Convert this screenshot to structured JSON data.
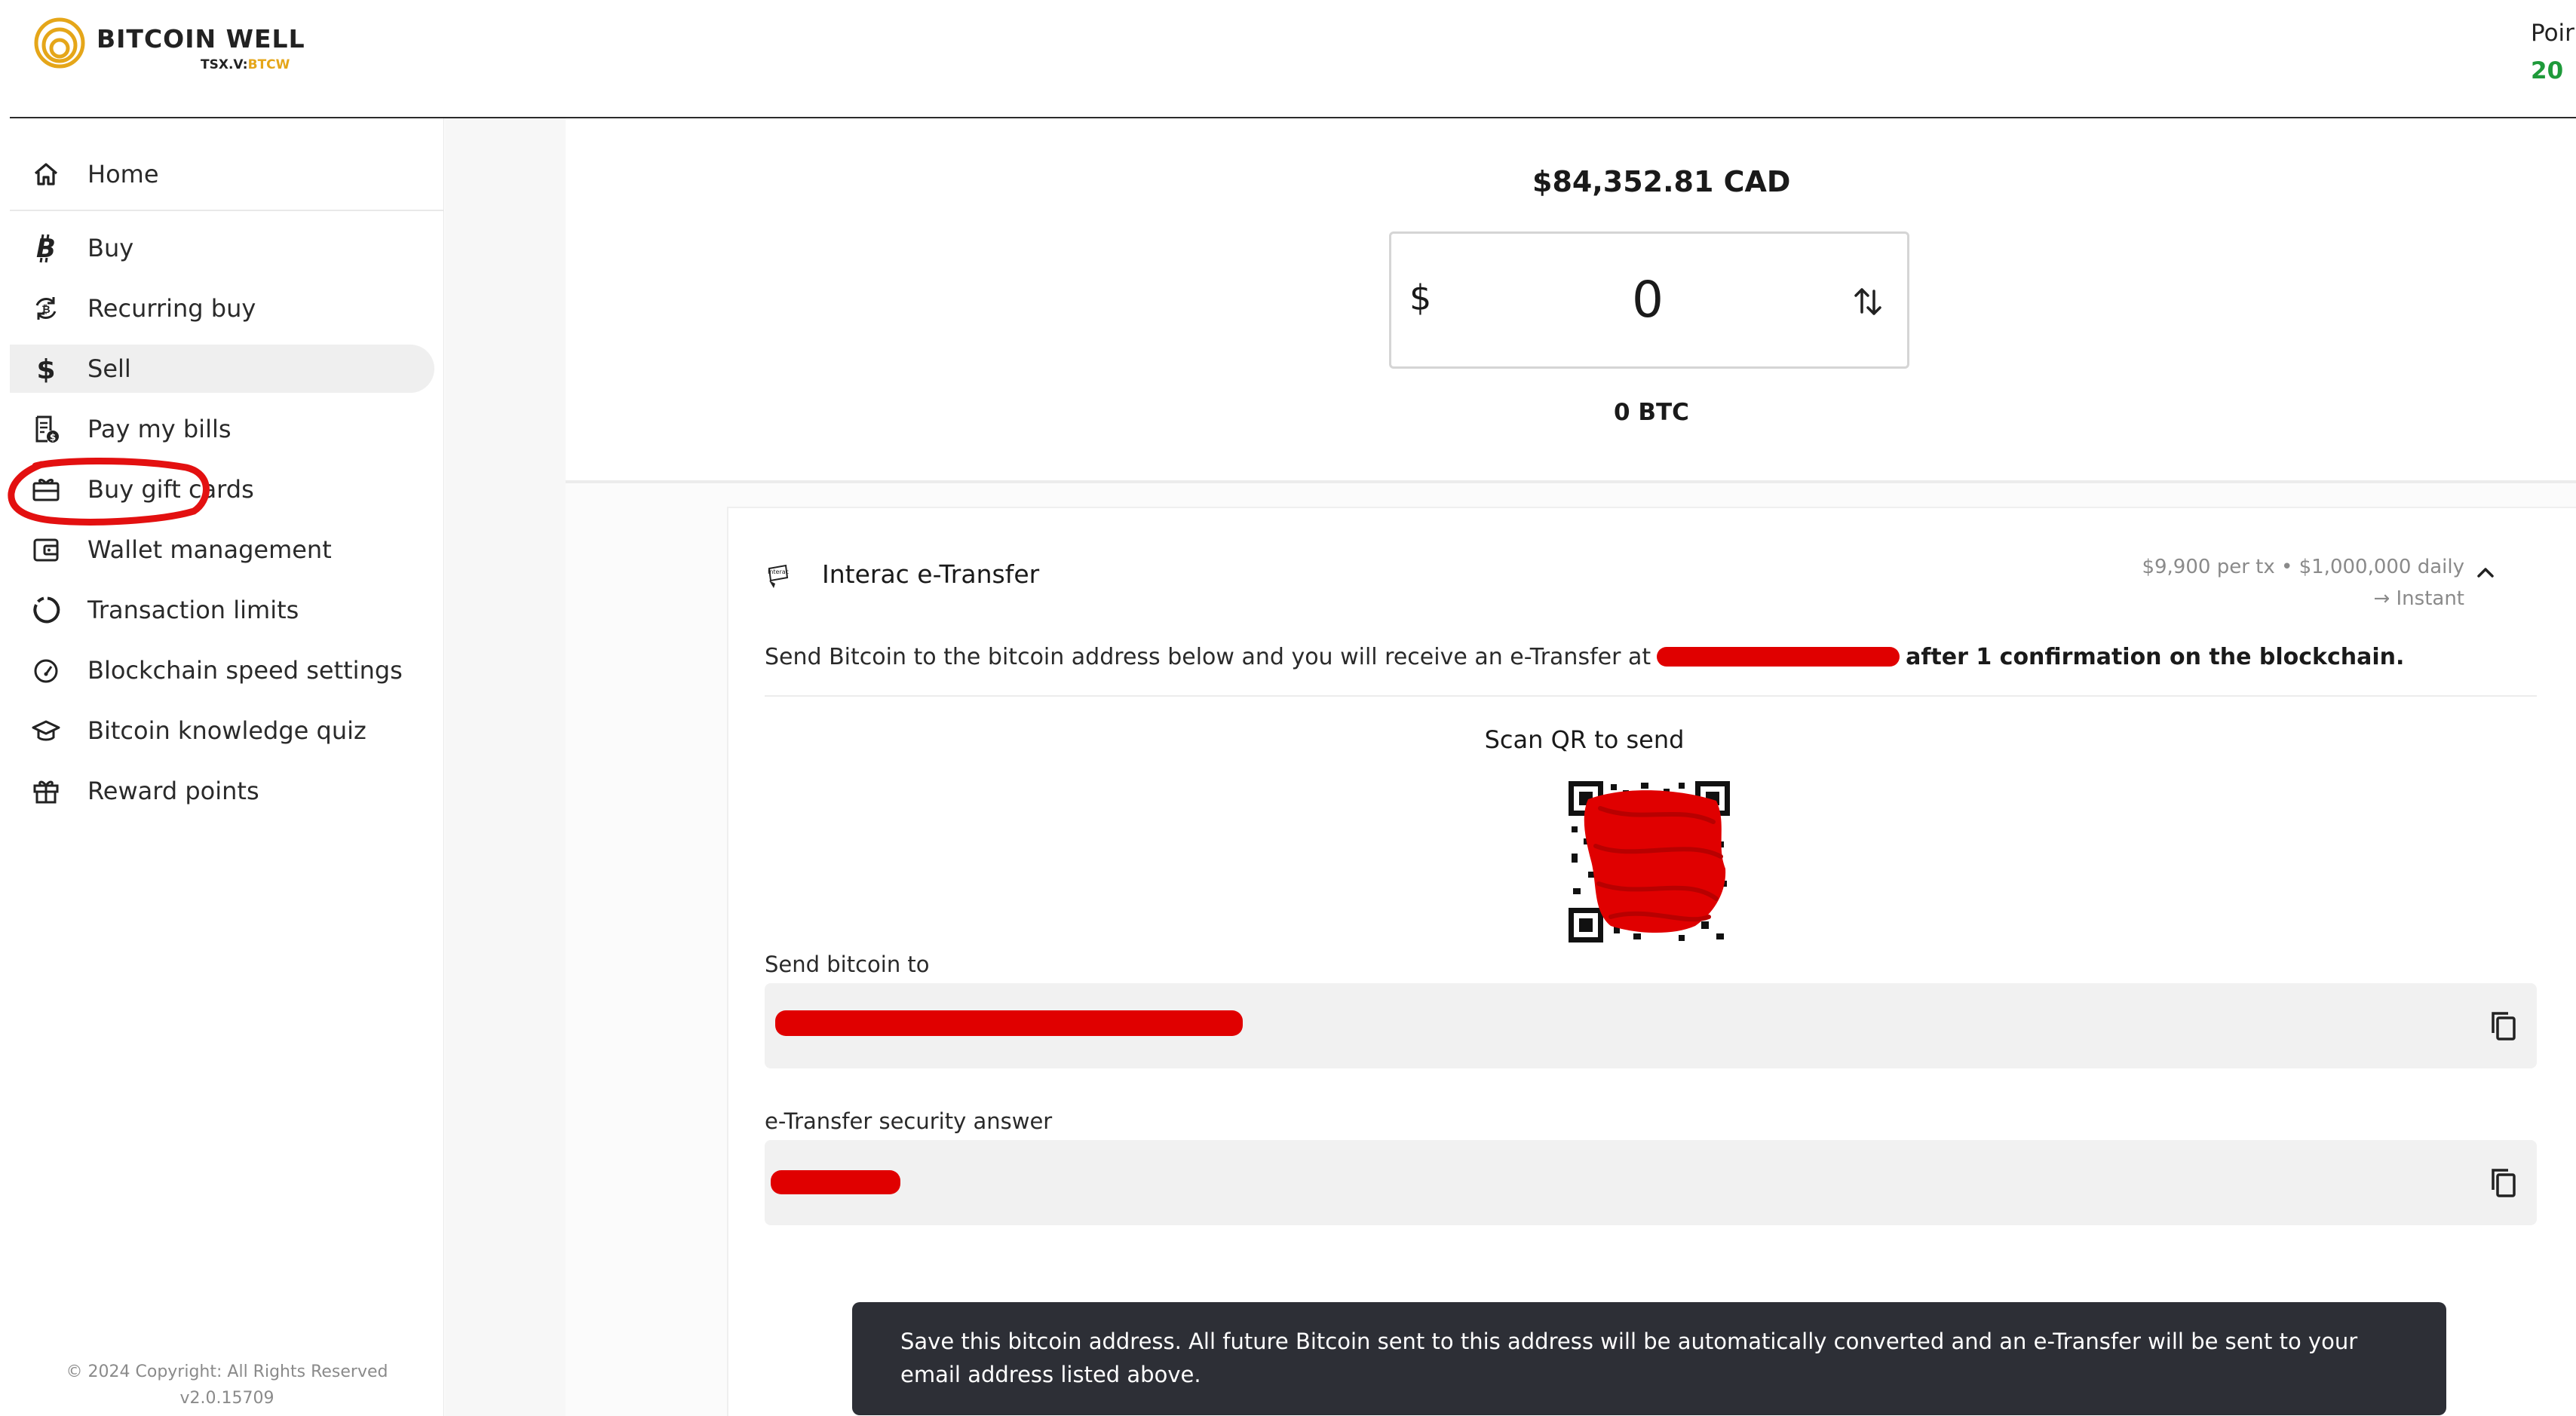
{
  "header": {
    "brand_name": "BITCOIN WELL",
    "ticker_prefix": "TSX.V:",
    "ticker_symbol": "BTCW",
    "points_label": "Poir",
    "points_value": "20"
  },
  "sidebar": {
    "items": [
      {
        "label": "Home",
        "icon": "home-icon"
      },
      {
        "label": "Buy",
        "icon": "bitcoin-icon"
      },
      {
        "label": "Recurring buy",
        "icon": "recurring-icon"
      },
      {
        "label": "Sell",
        "icon": "dollar-icon",
        "active": true
      },
      {
        "label": "Pay my bills",
        "icon": "bill-icon"
      },
      {
        "label": "Buy gift cards",
        "icon": "gift-card-icon"
      },
      {
        "label": "Wallet management",
        "icon": "wallet-icon"
      },
      {
        "label": "Transaction limits",
        "icon": "limits-icon"
      },
      {
        "label": "Blockchain speed settings",
        "icon": "speedometer-icon"
      },
      {
        "label": "Bitcoin knowledge quiz",
        "icon": "graduation-cap-icon"
      },
      {
        "label": "Reward points",
        "icon": "gift-icon"
      }
    ],
    "copyright": "© 2024 Copyright: All Rights Reserved",
    "version": "v2.0.15709"
  },
  "main": {
    "price": "$84,352.81 CAD",
    "currency_symbol": "$",
    "amount_value": "0",
    "btc_amount": "0 BTC",
    "payment_method": {
      "title": "Interac e-Transfer",
      "limits": "$9,900 per tx • $1,000,000 daily",
      "speed": "→ Instant",
      "instruction_before": "Send Bitcoin to the bitcoin address below and you will receive an e-Transfer at",
      "instruction_after": "after 1 confirmation on the blockchain.",
      "qr_label": "Scan QR to send",
      "send_to_label": "Send bitcoin to",
      "security_label": "e-Transfer security answer"
    },
    "toast": "Save this bitcoin address. All future Bitcoin sent to this address will be automatically converted and an e-Transfer will be sent to your email address listed above."
  },
  "colors": {
    "brand_gold": "#e5a619",
    "points_green": "#1e9a3a",
    "redaction_red": "#e00000",
    "toast_bg": "#2d2f36"
  }
}
